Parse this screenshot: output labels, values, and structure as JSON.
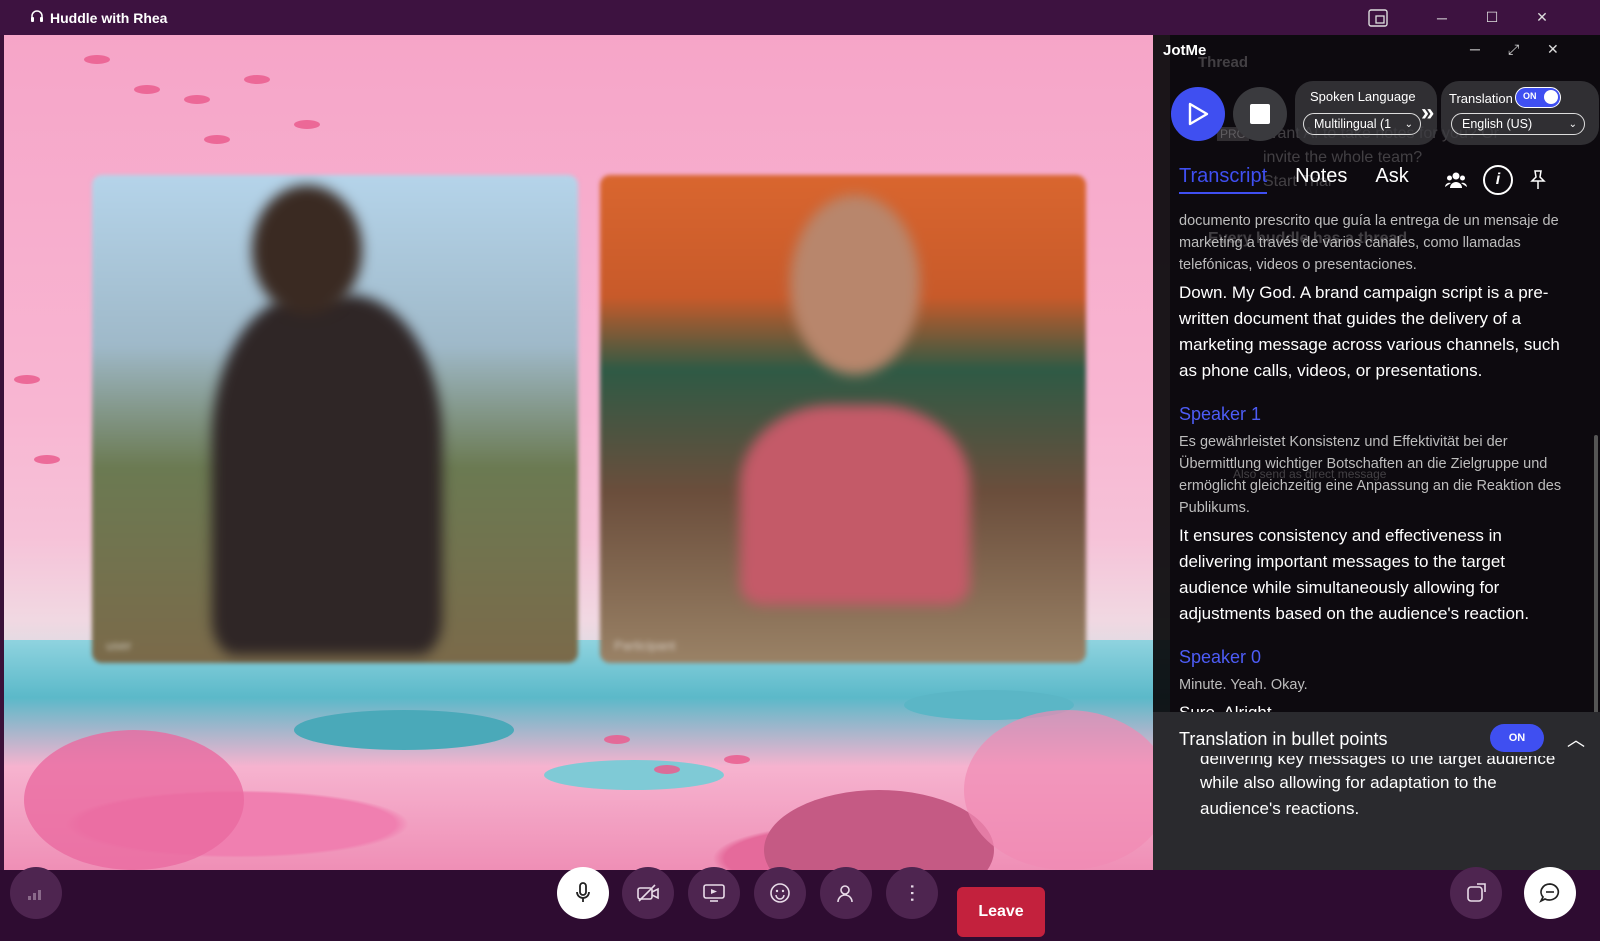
{
  "window": {
    "title": "Huddle with Rhea"
  },
  "participants": [
    {
      "name": "user"
    },
    {
      "name": "Participant"
    }
  ],
  "controls": {
    "leave_label": "Leave"
  },
  "jotme": {
    "app_name": "JotMe",
    "ghost": {
      "thread_title": "Thread",
      "pro_badge": "PRO",
      "pro_text_1": "Want AI to take notes for you? Or",
      "pro_text_2": "invite the whole team?",
      "trial": "Start Trial",
      "thread_notice": "Every huddle has a thread",
      "direct_message": "Also send as direct message"
    },
    "spoken_language": {
      "label": "Spoken Language",
      "value": "Multilingual (1"
    },
    "translation": {
      "label": "Translation",
      "toggle": "ON",
      "value": "English (US)"
    },
    "tabs": [
      "Transcript",
      "Notes",
      "Ask"
    ],
    "transcript": [
      {
        "original": "documento prescrito que guía la entrega de un mensaje de marketing a través de varios canales, como llamadas telefónicas, videos o presentaciones.",
        "translation": "Down. My God. A brand campaign script is a pre-written document that guides the delivery of a marketing message across various channels, such as phone calls, videos, or presentations."
      },
      {
        "speaker": "Speaker 1",
        "original": "Es gewährleistet Konsistenz und Effektivität bei der Übermittlung wichtiger Botschaften an die Zielgruppe und ermöglicht gleichzeitig eine Anpassung an die Reaktion des Publikums.",
        "translation": "It ensures consistency and effectiveness in delivering important messages to the target audience while simultaneously allowing for adjustments based on the audience's reaction."
      },
      {
        "speaker": "Speaker 0",
        "original": "Minute. Yeah. Okay.",
        "translation": "Sure. Alright."
      }
    ],
    "bullets": {
      "title": "Translation in bullet points",
      "toggle": "ON",
      "text_1": "delivering key messages to the target audience",
      "text_2": "while also allowing for adaptation to the",
      "text_3": "audience's reactions."
    }
  }
}
